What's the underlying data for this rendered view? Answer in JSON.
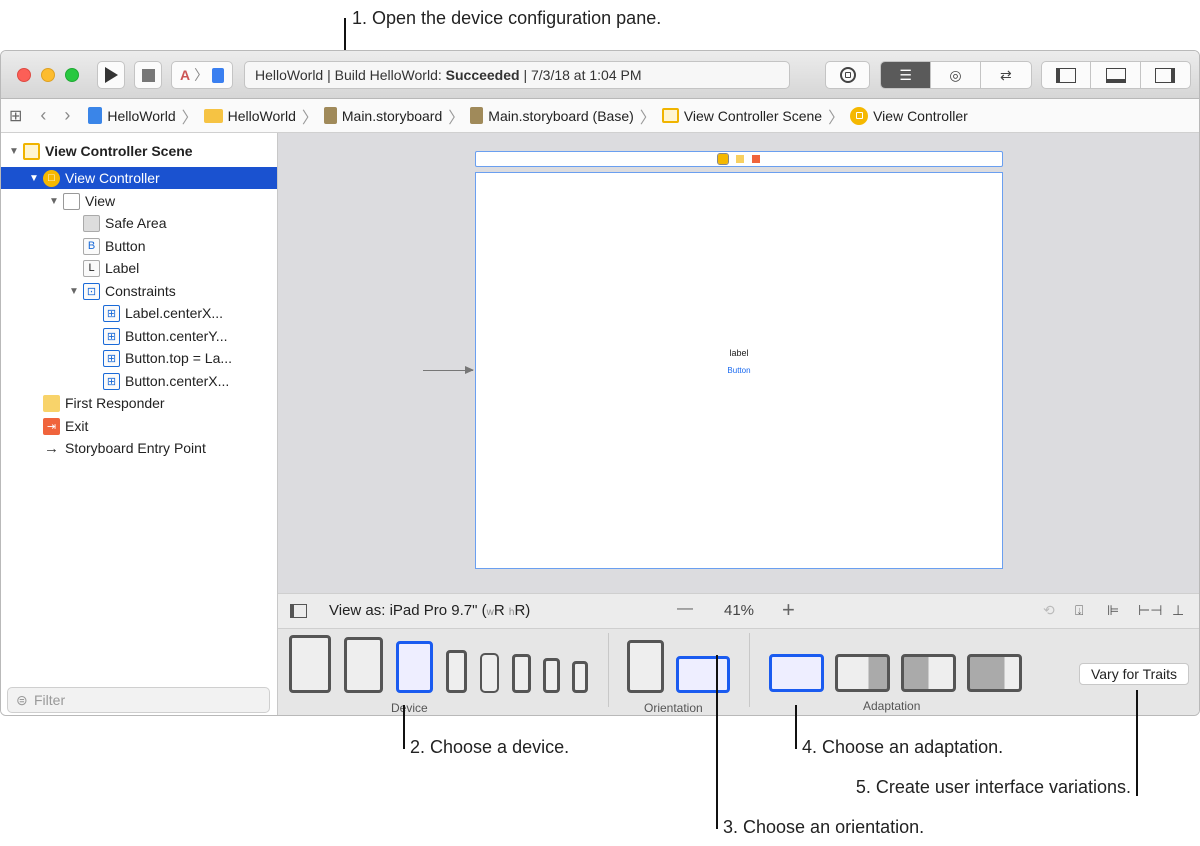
{
  "annotations": [
    "1. Open the device configuration pane.",
    "2. Choose a device.",
    "3. Choose an orientation.",
    "4. Choose an adaptation.",
    "5. Create user interface variations."
  ],
  "toolbar": {
    "status_prefix": "HelloWorld | Build HelloWorld: ",
    "status_result": "Succeeded",
    "status_suffix": " | 7/3/18 at 1:04 PM"
  },
  "breadcrumbs": [
    "HelloWorld",
    "HelloWorld",
    "Main.storyboard",
    "Main.storyboard (Base)",
    "View Controller Scene",
    "View Controller"
  ],
  "outline": [
    {
      "label": "View Controller Scene",
      "icon": "scene-icon",
      "level": 0,
      "expanded": true
    },
    {
      "label": "View Controller",
      "icon": "view-controller-icon",
      "level": 1,
      "expanded": true,
      "selected": true
    },
    {
      "label": "View",
      "icon": "view-icon",
      "level": 2,
      "expanded": true
    },
    {
      "label": "Safe Area",
      "icon": "safe-area-icon",
      "level": 3
    },
    {
      "label": "Button",
      "icon": "button-icon",
      "level": 3,
      "glyph": "B"
    },
    {
      "label": "Label",
      "icon": "label-icon",
      "level": 3,
      "glyph": "L"
    },
    {
      "label": "Constraints",
      "icon": "constraints-icon",
      "level": 3,
      "expanded": true
    },
    {
      "label": "Label.centerX...",
      "icon": "constraint-icon",
      "level": 4
    },
    {
      "label": "Button.centerY...",
      "icon": "constraint-icon",
      "level": 4
    },
    {
      "label": "Button.top = La...",
      "icon": "constraint-icon",
      "level": 4
    },
    {
      "label": "Button.centerX...",
      "icon": "constraint-icon",
      "level": 4
    },
    {
      "label": "First Responder",
      "icon": "first-responder-icon",
      "level": 1
    },
    {
      "label": "Exit",
      "icon": "exit-icon",
      "level": 1
    },
    {
      "label": "Storyboard Entry Point",
      "icon": "arrow-icon",
      "level": 1
    }
  ],
  "filter": {
    "placeholder": "Filter"
  },
  "scene": {
    "label_text": "label",
    "button_text": "Button"
  },
  "bottombar": {
    "view_as_prefix": "View as: iPad Pro 9.7\" (",
    "w": "w",
    "wr": "R",
    "h": "h",
    "hr": "R)",
    "zoom": "41%",
    "minus": "—",
    "plus": "+"
  },
  "config": {
    "device_caption": "Device",
    "orientation_caption": "Orientation",
    "adaptation_caption": "Adaptation",
    "vary_button": "Vary for Traits",
    "selected_device": "iPad Pro 9.7\""
  }
}
